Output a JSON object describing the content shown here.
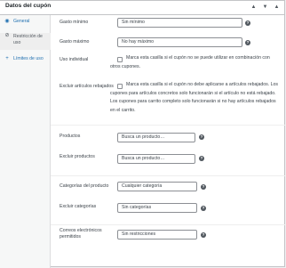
{
  "header": {
    "title": "Datos del cupón",
    "btn_up": "▲",
    "btn_down": "▼",
    "btn_collapse": "▲"
  },
  "tabs": [
    {
      "label": "General",
      "icon": "globe-icon"
    },
    {
      "label": "Restricción de uso",
      "icon": "block-icon"
    },
    {
      "label": "Límites de uso",
      "icon": "plus-icon"
    }
  ],
  "fields": {
    "min_spend": {
      "label": "Gasto mínimo",
      "placeholder": "Sin mínimo"
    },
    "max_spend": {
      "label": "Gasto máximo",
      "placeholder": "No hay máximo"
    },
    "individual": {
      "label": "Uso individual",
      "desc": "Marca esta casilla si el cupón no se puede utilizar en combinación con otros cupones."
    },
    "exclude_sale": {
      "label": "Excluir artículos rebajados",
      "desc": "Marca esta casilla si el cupón no debe aplicarse a artículos rebajados. Los cupones para artículos concretos solo funcionarán si el artículo no está rebajado. Los cupones para carrito completo solo funcionarán si no hay artículos rebajados en el carrito."
    },
    "products": {
      "label": "Productos",
      "placeholder": "Busca un producto…"
    },
    "exclude_products": {
      "label": "Excluir productos",
      "placeholder": "Busca un producto…"
    },
    "categories": {
      "label": "Categorías del producto",
      "placeholder": "Cualquier categoría"
    },
    "exclude_categories": {
      "label": "Excluir categorías",
      "placeholder": "Sin categorías"
    },
    "emails": {
      "label": "Correos electrónicos permitidos",
      "placeholder": "Sin restricciones"
    }
  },
  "help_glyph": "?"
}
